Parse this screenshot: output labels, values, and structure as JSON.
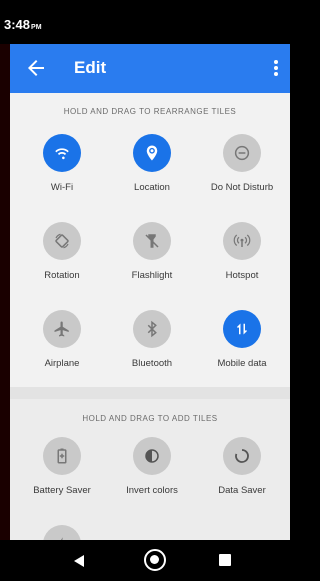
{
  "status": {
    "time": "3:48",
    "ampm": "PM"
  },
  "header": {
    "title": "Edit"
  },
  "sections": {
    "rearrange_title": "HOLD AND DRAG TO REARRANGE TILES",
    "add_title": "HOLD AND DRAG TO ADD TILES"
  },
  "colors": {
    "accent": "#2a7cef",
    "active_tile": "#1a73e8",
    "inactive_tile": "#c9c9c9"
  },
  "active_tiles": [
    {
      "label": "Wi-Fi",
      "icon": "wifi-icon",
      "active": true
    },
    {
      "label": "Location",
      "icon": "location-icon",
      "active": true
    },
    {
      "label": "Do Not Disturb",
      "icon": "do-not-disturb-icon",
      "active": false
    },
    {
      "label": "Rotation",
      "icon": "rotation-icon",
      "active": false
    },
    {
      "label": "Flashlight",
      "icon": "flashlight-icon",
      "active": false
    },
    {
      "label": "Hotspot",
      "icon": "hotspot-icon",
      "active": false
    },
    {
      "label": "Airplane",
      "icon": "airplane-icon",
      "active": false
    },
    {
      "label": "Bluetooth",
      "icon": "bluetooth-icon",
      "active": false
    },
    {
      "label": "Mobile data",
      "icon": "mobile-data-icon",
      "active": true
    }
  ],
  "available_tiles": [
    {
      "label": "Battery Saver",
      "icon": "battery-saver-icon"
    },
    {
      "label": "Invert colors",
      "icon": "invert-colors-icon"
    },
    {
      "label": "Data Saver",
      "icon": "data-saver-icon"
    }
  ]
}
